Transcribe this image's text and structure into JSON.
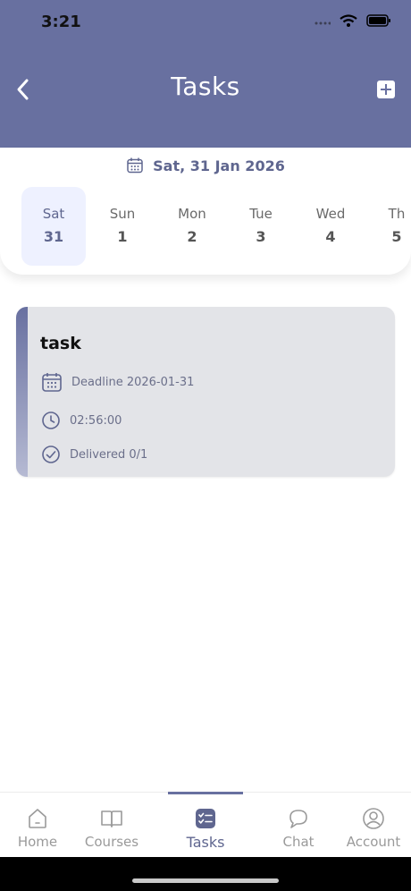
{
  "status_bar": {
    "time": "3:21"
  },
  "header": {
    "title": "Tasks",
    "back_icon": "chevron-left-icon",
    "add_icon": "plus-square-icon"
  },
  "calendar": {
    "selected_date": "Sat, 31 Jan 2026",
    "days": [
      {
        "name": "Sat",
        "num": "31",
        "selected": true
      },
      {
        "name": "Sun",
        "num": "1",
        "selected": false
      },
      {
        "name": "Mon",
        "num": "2",
        "selected": false
      },
      {
        "name": "Tue",
        "num": "3",
        "selected": false
      },
      {
        "name": "Wed",
        "num": "4",
        "selected": false
      },
      {
        "name": "Th",
        "num": "5",
        "selected": false
      }
    ]
  },
  "task": {
    "title": "task",
    "deadline": "Deadline 2026-01-31",
    "time": "02:56:00",
    "delivered": "Delivered 0/1"
  },
  "bottom_nav": {
    "items": [
      {
        "label": "Home",
        "icon": "home-icon"
      },
      {
        "label": "Courses",
        "icon": "book-icon"
      },
      {
        "label": "Tasks",
        "icon": "tasks-icon",
        "active": true
      },
      {
        "label": "Chat",
        "icon": "chat-icon"
      },
      {
        "label": "Account",
        "icon": "account-icon"
      }
    ]
  },
  "colors": {
    "accent": "#6870a0",
    "selected_day_bg": "#eef1ff",
    "card_bg": "#e3e4e8"
  }
}
